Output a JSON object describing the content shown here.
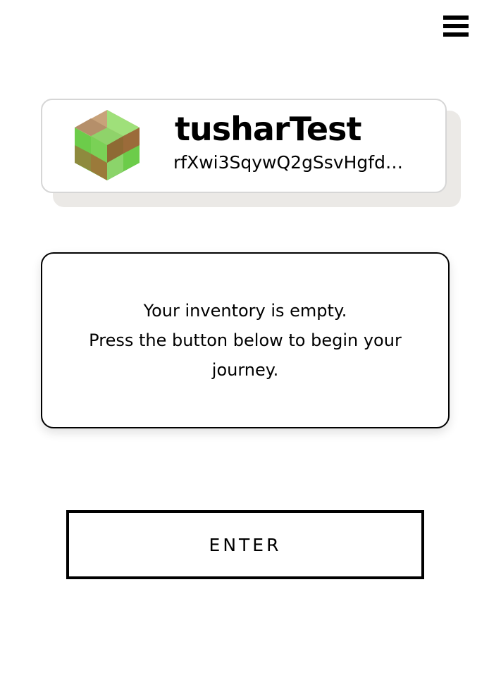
{
  "header": {
    "menu_icon": "hamburger-menu-icon"
  },
  "profile": {
    "username": "tusharTest",
    "address": "rfXwi3SqywQ2gSsvHgfdVs...",
    "avatar_icon": "hex-cube-avatar-icon",
    "avatar_colors": {
      "light_green": "#9fe07a",
      "green": "#6ccc4a",
      "tan": "#b58f6a",
      "brown": "#9b6b3a",
      "olive": "#8e8a3e"
    }
  },
  "inventory": {
    "line1": "Your inventory is empty.",
    "line2": "Press the button below to begin your journey."
  },
  "enter_button": {
    "label": "ENTER"
  }
}
